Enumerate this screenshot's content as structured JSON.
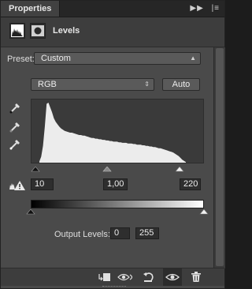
{
  "panel": {
    "tab_label": "Properties",
    "header_title": "Levels"
  },
  "preset": {
    "label": "Preset:",
    "value": "Custom"
  },
  "channel": {
    "value": "RGB"
  },
  "auto_button": "Auto",
  "inputs": {
    "black": "10",
    "gamma": "1,00",
    "white": "220"
  },
  "output": {
    "label": "Output Levels:",
    "black": "0",
    "white": "255"
  },
  "icons": {
    "top": [
      "expand-icon",
      "panel-menu-icon"
    ],
    "header": [
      "histogram-adjustment-icon",
      "mask-icon"
    ],
    "droppers": [
      "black-point-eyedropper-icon",
      "gray-point-eyedropper-icon",
      "white-point-eyedropper-icon"
    ],
    "warning": "clipping-warning-icon",
    "footer": [
      "clip-to-layer-icon",
      "view-previous-state-icon",
      "reset-icon",
      "visibility-icon",
      "delete-icon"
    ]
  },
  "histogram": {
    "levels": [
      2,
      10,
      28,
      60,
      98,
      100,
      92,
      84,
      74,
      68,
      64,
      60,
      57,
      55,
      53,
      52,
      51,
      50,
      50,
      49,
      48,
      47,
      46,
      46,
      45,
      45,
      44,
      43,
      42,
      41,
      41,
      40,
      40,
      39,
      39,
      38,
      38,
      37,
      37,
      36,
      36,
      35,
      35,
      35,
      34,
      34,
      33,
      33,
      33,
      32,
      32,
      32,
      31,
      31,
      30,
      30,
      30,
      29,
      29,
      28,
      28,
      27,
      27,
      26,
      26,
      25,
      24,
      24,
      23,
      22,
      21,
      20,
      19,
      18,
      17,
      15,
      13,
      11,
      8,
      5,
      3,
      1
    ]
  }
}
